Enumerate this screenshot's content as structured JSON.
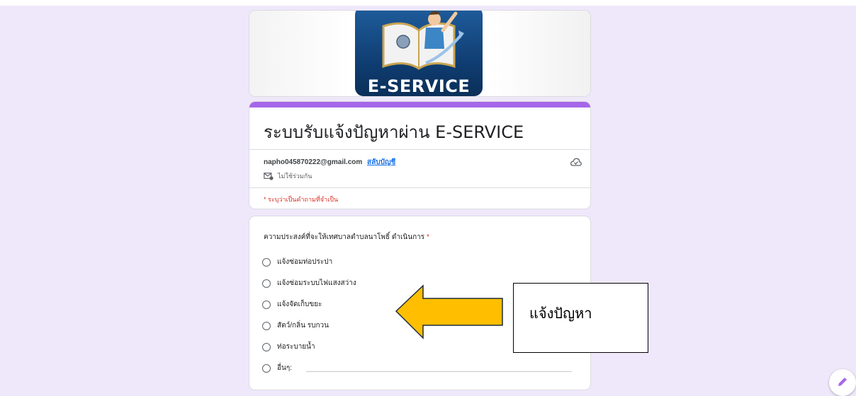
{
  "banner": {
    "logo_text": "E-SERVICE"
  },
  "form": {
    "title": "ระบบรับแจ้งปัญหาผ่าน E-SERVICE",
    "account_email": "napho045870222@gmail.com",
    "switch_account": "สลับบัญชี",
    "not_shared": "ไม่ใช้ร่วมกัน",
    "required_note": "* ระบุว่าเป็นคำถามที่จำเป็น"
  },
  "question": {
    "title": "ความประสงค์ที่จะให้เทศบาลตำบลนาโพธิ์ ดำเนินการ",
    "required_mark": "*",
    "options": [
      "แจ้งซ่อมท่อประปา",
      "แจ้งซ่อมระบบไฟแสงสว่าง",
      "แจ้งจัดเก็บขยะ",
      "สัตว์/กลิ่น รบกวน",
      "ท่อระบายน้ำ",
      "อื่นๆ:"
    ]
  },
  "annotation": {
    "callout_text": "แจ้งปัญหา"
  },
  "colors": {
    "accent": "#a567e9",
    "background": "#efe8fb",
    "arrow": "#ffbf00",
    "required": "#d93025"
  },
  "icons": [
    "cloud-check-icon",
    "mail-share-icon",
    "edit-pencil-icon"
  ]
}
